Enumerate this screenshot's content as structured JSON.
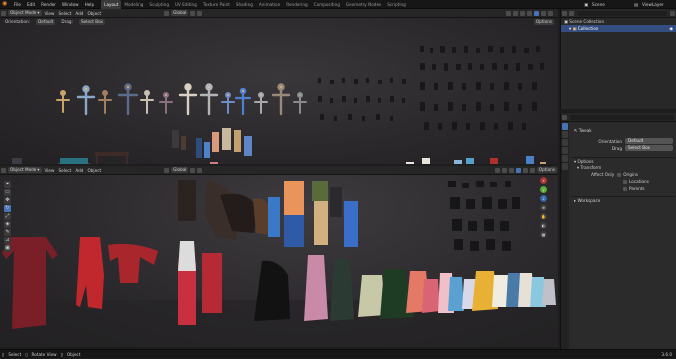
{
  "topbar": {
    "menus": [
      "File",
      "Edit",
      "Render",
      "Window",
      "Help"
    ],
    "workspaces": [
      "Layout",
      "Modeling",
      "Sculpting",
      "UV Editing",
      "Texture Paint",
      "Shading",
      "Animation",
      "Rendering",
      "Compositing",
      "Geometry Nodes",
      "Scripting"
    ],
    "active_workspace": "Layout",
    "scene": "Scene",
    "view_layer": "ViewLayer"
  },
  "viewport_top": {
    "mode": "Object Mode",
    "menus": [
      "View",
      "Select",
      "Add",
      "Object"
    ],
    "orientation_label": "Orientation:",
    "orientation": "Default",
    "drag_label": "Drag:",
    "drag": "Select Box",
    "pivot": "Global",
    "options": "Options"
  },
  "viewport_bottom": {
    "mode": "Object Mode",
    "menus": [
      "View",
      "Select",
      "Add",
      "Object"
    ],
    "pivot": "Global",
    "options": "Options"
  },
  "outliner": {
    "items": [
      "Scene Collection",
      "Collection"
    ]
  },
  "properties": {
    "tool_name": "Tweak",
    "orientation_label": "Orientation",
    "orientation": "Default",
    "drag_label": "Drag",
    "drag": "Select Box",
    "options_header": "Options",
    "transform_header": "Transform",
    "affect_only_label": "Affect Only",
    "affect_only_items": [
      "Origins",
      "Locations",
      "Parents"
    ],
    "workspace_header": "Workspace"
  },
  "statusbar": {
    "items": [
      "Select",
      "Rotate View",
      "Object"
    ],
    "version": "3.6.0"
  },
  "colors": {
    "accent": "#4772b3",
    "brand": "#e88a2e",
    "active_collection": "#f0c080"
  }
}
